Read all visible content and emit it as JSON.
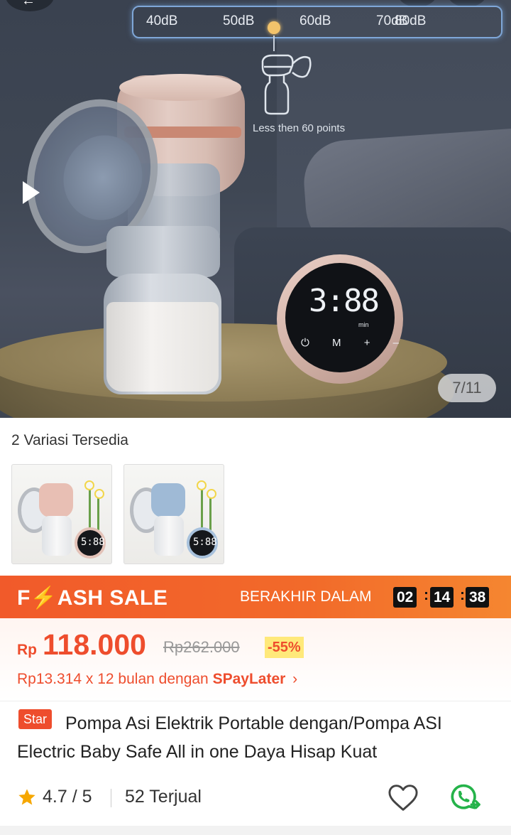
{
  "hero": {
    "db_labels": [
      "40dB",
      "50dB",
      "60dB",
      "70dB",
      "80dB"
    ],
    "pump_caption": "Less then 60 points",
    "controller_digits": "3:88",
    "controller_unit": "min",
    "controller_buttons": "⏻ M + –",
    "image_counter": "7/11"
  },
  "variations": {
    "title": "2 Variasi Tersedia",
    "items": [
      {
        "color": "#e8bfb4",
        "ring": "#e3c2b8"
      },
      {
        "color": "#9fbad6",
        "ring": "#a7c1dc"
      }
    ],
    "thumb_digits": "5:88"
  },
  "flash_sale": {
    "title_prefix": "F",
    "title_rest": "ASH SALE",
    "ends_label": "BERAKHIR DALAM",
    "hours": "02",
    "minutes": "14",
    "seconds": "38"
  },
  "price": {
    "currency": "Rp",
    "amount": "118.000",
    "original": "Rp262.000",
    "discount": "-55%",
    "installment": "Rp13.314 x 12 bulan dengan ",
    "paylater_brand": "SPayLater",
    "chevron": "›"
  },
  "product": {
    "badge": "Star",
    "title": "Pompa Asi Elektrik Portable dengan/Pompa ASI Electric Baby Safe All in one Daya Hisap Kuat"
  },
  "stats": {
    "rating": "4.7 / 5",
    "sold": "52 Terjual"
  },
  "colors": {
    "accent": "#ee4d2d",
    "flash_bg": "#f15a2a",
    "discount_bg": "#ffe97a"
  }
}
